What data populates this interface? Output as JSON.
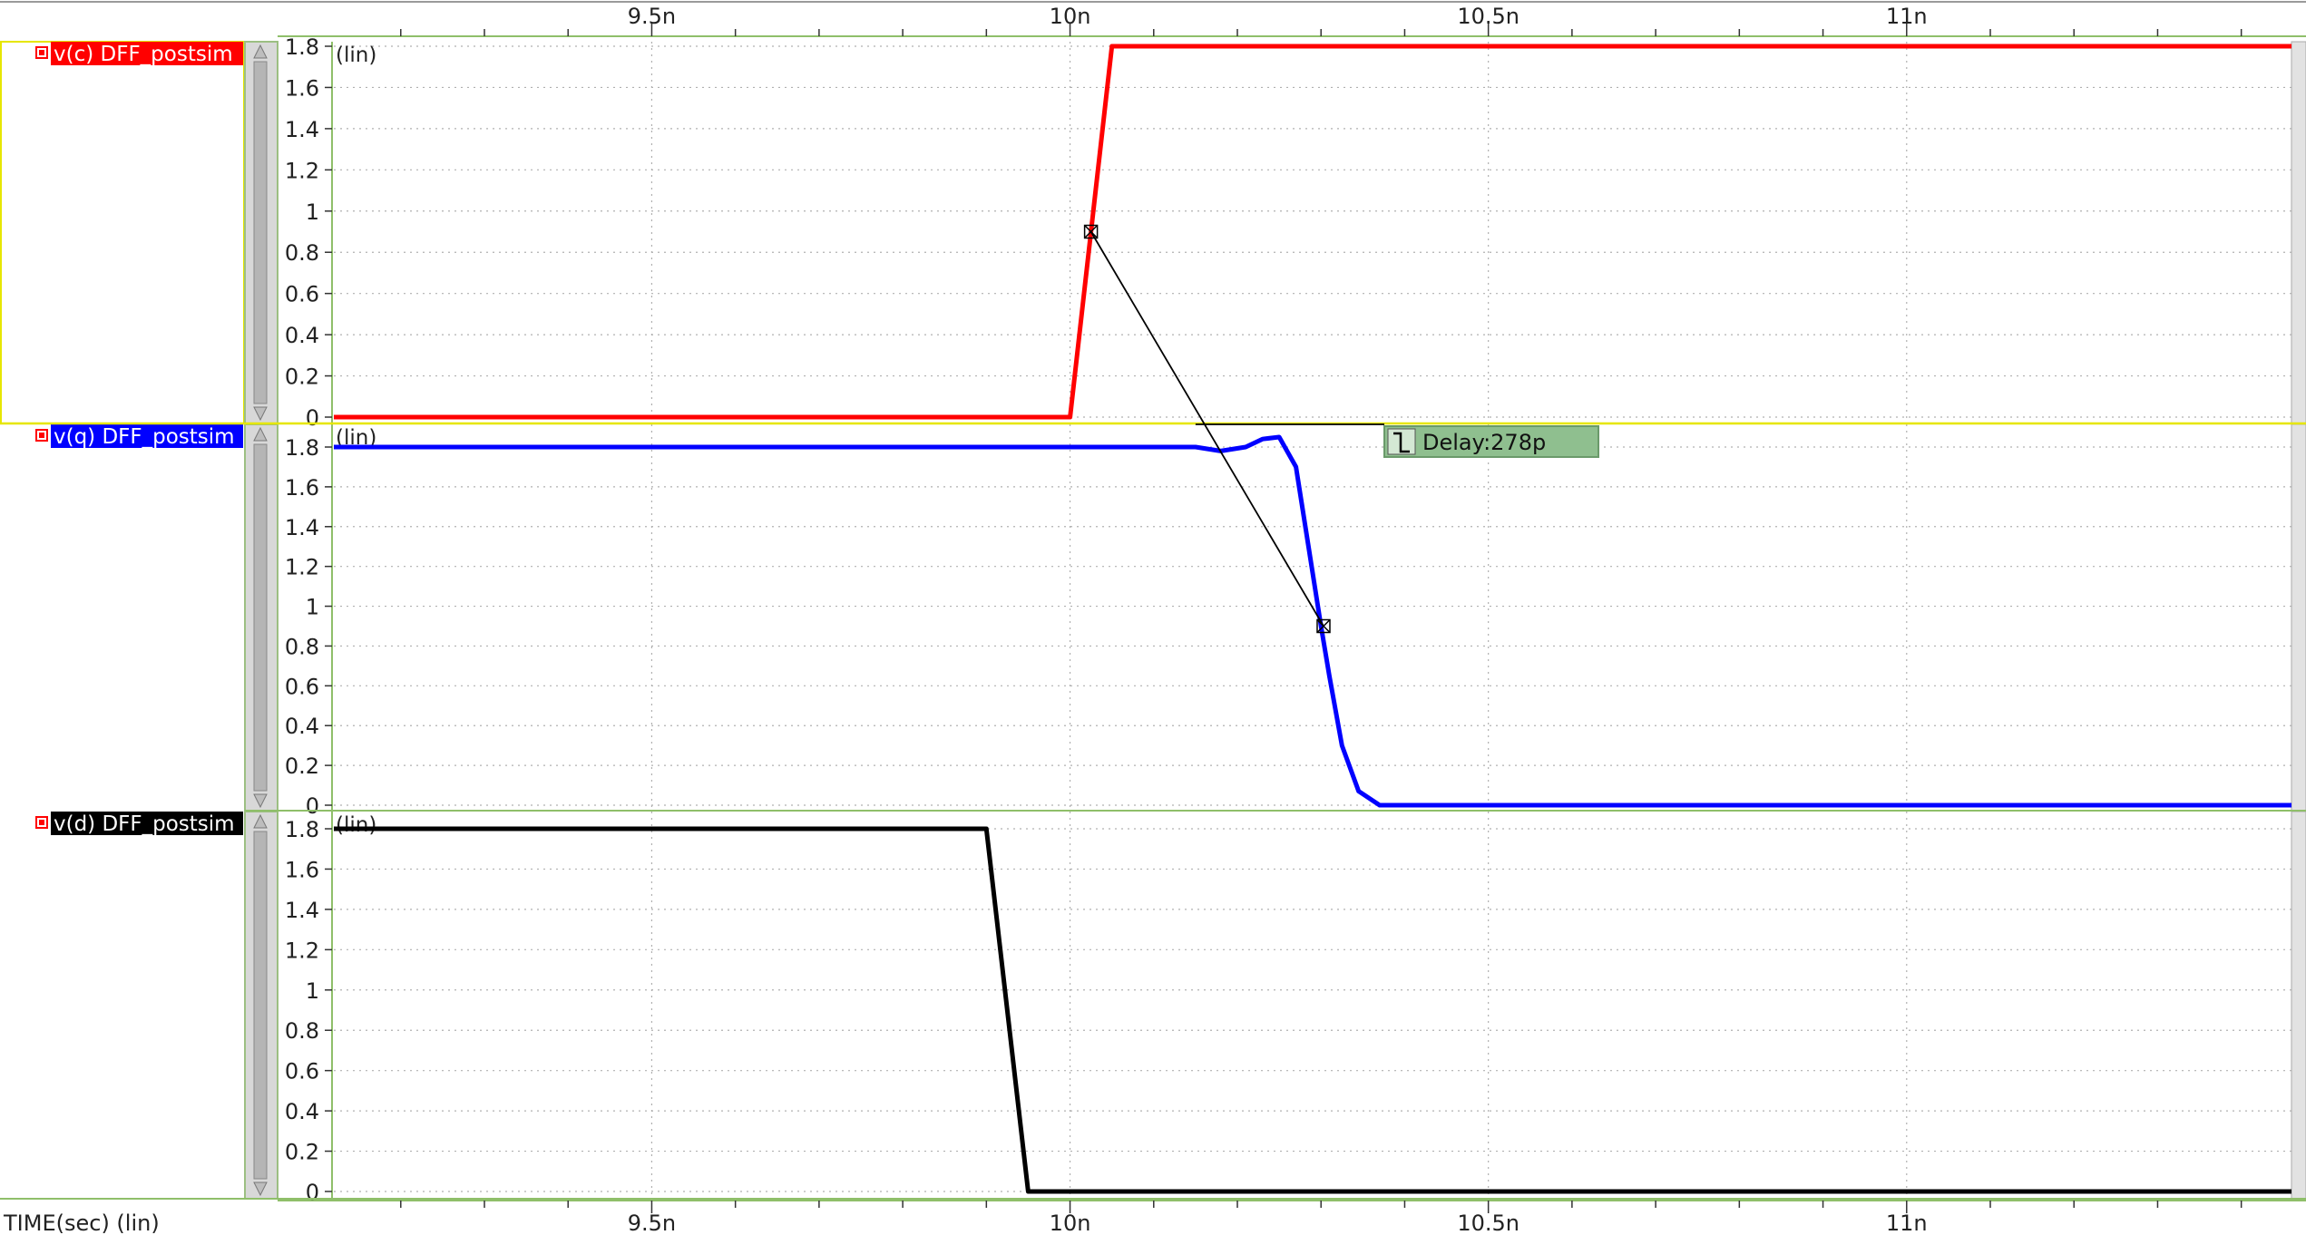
{
  "x_unit_label": "TIME(sec) (lin)",
  "x_ticks": [
    {
      "value": 9.5,
      "label": "9.5n"
    },
    {
      "value": 10.0,
      "label": "10n"
    },
    {
      "value": 10.5,
      "label": "10.5n"
    },
    {
      "value": 11.0,
      "label": "11n"
    }
  ],
  "measurement": {
    "label": "Delay:278p",
    "from_signal": 0,
    "from_x": 10.025,
    "from_y": 0.9,
    "to_signal": 1,
    "to_x": 10.303,
    "to_y": 0.9
  },
  "panels": [
    {
      "name": "v(c) DFF_postsim",
      "scale_label": "(lin)",
      "color": "#ff0000",
      "selected": true
    },
    {
      "name": "v(q) DFF_postsim",
      "scale_label": "(lin)",
      "color": "#0000ff",
      "selected": false
    },
    {
      "name": "v(d) DFF_postsim",
      "scale_label": "(lin)",
      "color": "#000000",
      "selected": false
    }
  ],
  "chart_data": {
    "type": "line",
    "title": "",
    "xlabel": "TIME(sec) (lin)",
    "xlim": [
      9.12,
      11.46
    ],
    "ylim": [
      0,
      1.8
    ],
    "y_ticks": [
      "0",
      "0.2",
      "0.4",
      "0.6",
      "0.8",
      "1",
      "1.2",
      "1.4",
      "1.6",
      "1.8"
    ],
    "grid": true,
    "series": [
      {
        "name": "v(c) DFF_postsim",
        "color": "#ff0000",
        "x": [
          9.12,
          10.0,
          10.05,
          11.46
        ],
        "y": [
          0,
          0,
          1.8,
          1.8
        ]
      },
      {
        "name": "v(q) DFF_postsim",
        "color": "#0000ff",
        "x": [
          9.12,
          10.15,
          10.18,
          10.21,
          10.23,
          10.25,
          10.27,
          10.285,
          10.3,
          10.31,
          10.325,
          10.345,
          10.37,
          10.42,
          11.46
        ],
        "y": [
          1.8,
          1.8,
          1.78,
          1.8,
          1.84,
          1.85,
          1.7,
          1.3,
          0.9,
          0.65,
          0.3,
          0.07,
          0.0,
          0.0,
          0.0
        ]
      },
      {
        "name": "v(d) DFF_postsim",
        "color": "#000000",
        "x": [
          9.12,
          9.9,
          9.95,
          11.46
        ],
        "y": [
          1.8,
          1.8,
          0,
          0
        ]
      }
    ]
  }
}
